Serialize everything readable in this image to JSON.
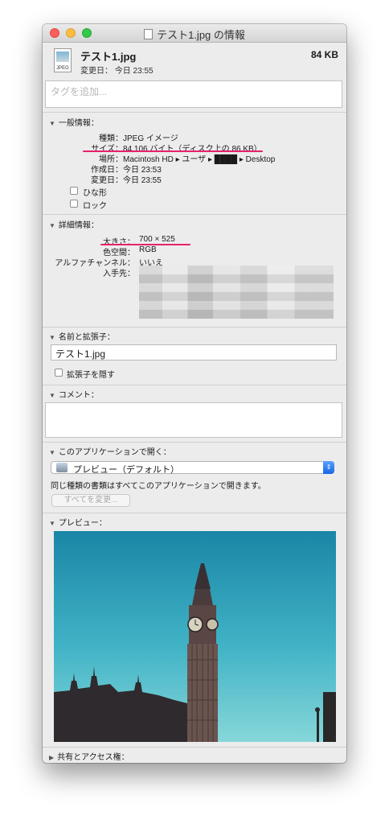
{
  "window": {
    "title": "テスト1.jpg の情報"
  },
  "header": {
    "file_name": "テスト1.jpg",
    "modified": "変更日： 今日 23:55",
    "size": "84 KB",
    "icon_label": "JPEG"
  },
  "tags": {
    "placeholder": "タグを追加..."
  },
  "general": {
    "title": "一般情報：",
    "rows": [
      {
        "label": "種類：",
        "value": "JPEG イメージ"
      },
      {
        "label": "サイズ：",
        "value": "84,106 バイト（ディスク上の 86 KB）"
      },
      {
        "label": "場所：",
        "value": "Macintosh HD ▸ ユーザ ▸ ████ ▸ Desktop"
      },
      {
        "label": "作成日：",
        "value": "今日 23:53"
      },
      {
        "label": "変更日：",
        "value": "今日 23:55"
      }
    ],
    "stationery_label": "ひな形",
    "locked_label": "ロック"
  },
  "details": {
    "title": "詳細情報：",
    "rows": [
      {
        "label": "大きさ：",
        "value": "700 × 525"
      },
      {
        "label": "色空間：",
        "value": "RGB"
      },
      {
        "label": "アルファチャンネル：",
        "value": "いいえ"
      },
      {
        "label": "入手先：",
        "value": ""
      }
    ]
  },
  "name_ext": {
    "title": "名前と拡張子：",
    "value": "テスト1.jpg",
    "hide_ext_label": "拡張子を隠す"
  },
  "comments": {
    "title": "コメント："
  },
  "open_with": {
    "title": "このアプリケーションで開く：",
    "selected_app": "プレビュー（デフォルト）",
    "description": "同じ種類の書類はすべてこのアプリケーションで開きます。",
    "change_all_label": "すべてを変更..."
  },
  "preview": {
    "title": "プレビュー："
  },
  "sharing": {
    "title": "共有とアクセス権："
  },
  "colors": {
    "annotation_underline": "#e5226a",
    "popup_accent": "#1767e6"
  }
}
